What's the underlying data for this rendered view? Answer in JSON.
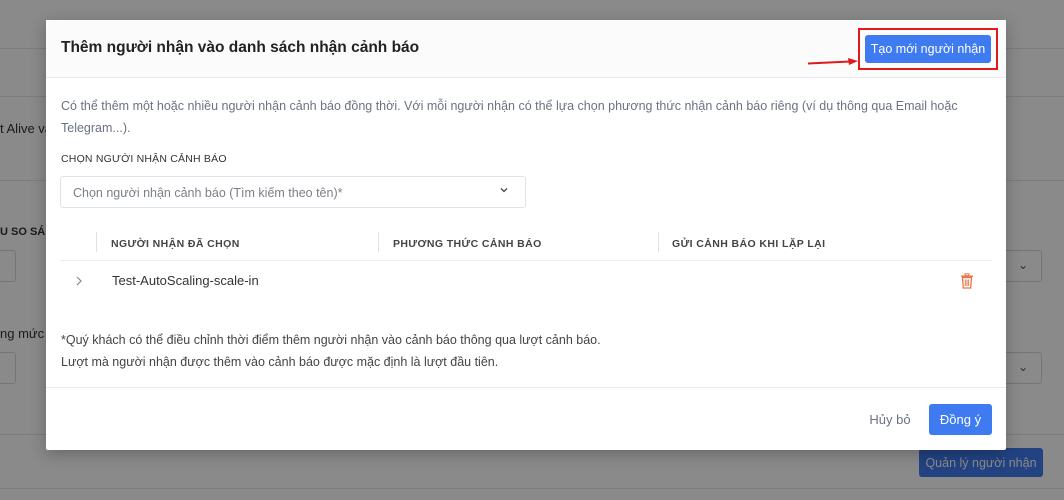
{
  "background": {
    "fragment_alive": "t Alive và",
    "fragment_compare": "U SO SÁNH",
    "fragment_equals": "=",
    "fragment_level": "ng mức c",
    "manage_recipients_label": "Quản lý người nhận"
  },
  "modal": {
    "title": "Thêm người nhận vào danh sách nhận cảnh báo",
    "create_button_label": "Tạo mới người nhận",
    "description": "Có thể thêm một hoặc nhiều người nhận cảnh báo đồng thời. Với mỗi người nhận có thể lựa chọn phương thức nhận cảnh báo riêng (ví dụ thông qua Email hoặc Telegram...).",
    "select_section_label": "CHỌN NGƯỜI NHẬN CẢNH BÁO",
    "select_placeholder": "Chọn người nhận cảnh báo (Tìm kiếm theo tên)*",
    "table": {
      "headers": [
        "NGƯỜI NHẬN ĐÃ CHỌN",
        "PHƯƠNG THỨC CẢNH BÁO",
        "GỬI CẢNH BÁO KHI LẶP LẠI"
      ],
      "rows": [
        {
          "name": "Test-AutoScaling-scale-in",
          "method": "",
          "repeat": ""
        }
      ]
    },
    "note_line1": "*Quý khách có thể điều chỉnh thời điểm thêm người nhận vào cảnh báo thông qua lượt cảnh báo.",
    "note_line2": "Lượt mà người nhận được thêm vào cảnh báo được mặc định là lượt đầu tiên.",
    "cancel_label": "Hủy bỏ",
    "ok_label": "Đồng ý"
  },
  "colors": {
    "primary": "#3f7bf0",
    "highlight_box": "#e0191b",
    "delete_icon": "#e8734a"
  }
}
